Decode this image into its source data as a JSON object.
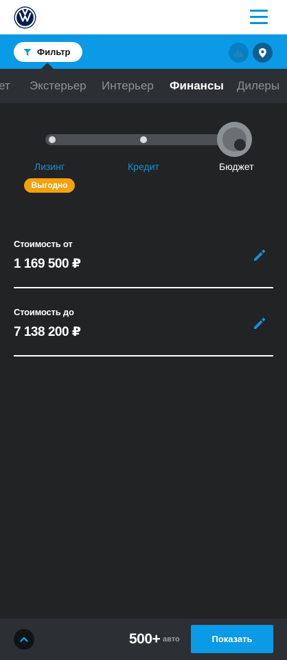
{
  "header": {
    "logo": "vw-logo",
    "menu_icon": "hamburger-icon"
  },
  "filterbar": {
    "filter_label": "Фильтр",
    "filter_icon": "funnel-icon",
    "chart_icon": "bar-chart-icon",
    "map_icon": "map-pin-icon"
  },
  "tabs": [
    {
      "label": "ет"
    },
    {
      "label": "Экстерьер"
    },
    {
      "label": "Интерьер"
    },
    {
      "label": "Финансы",
      "active": true
    },
    {
      "label": "Дилеры"
    }
  ],
  "finance": {
    "steps": [
      {
        "label": "Лизинг"
      },
      {
        "label": "Кредит"
      },
      {
        "label": "Бюджет",
        "selected": true
      }
    ],
    "badge": "Выгодно",
    "price_from": {
      "label": "Стоимость от",
      "value": "1 169 500 ₽"
    },
    "price_to": {
      "label": "Стоимость до",
      "value": "7 138 200 ₽"
    }
  },
  "bottom": {
    "count": "500+",
    "count_unit": "авто",
    "show_label": "Показать"
  },
  "colors": {
    "accent": "#0a9ae6",
    "background": "#212325",
    "bar": "#2c2f33",
    "badge": "#f4a10b"
  }
}
